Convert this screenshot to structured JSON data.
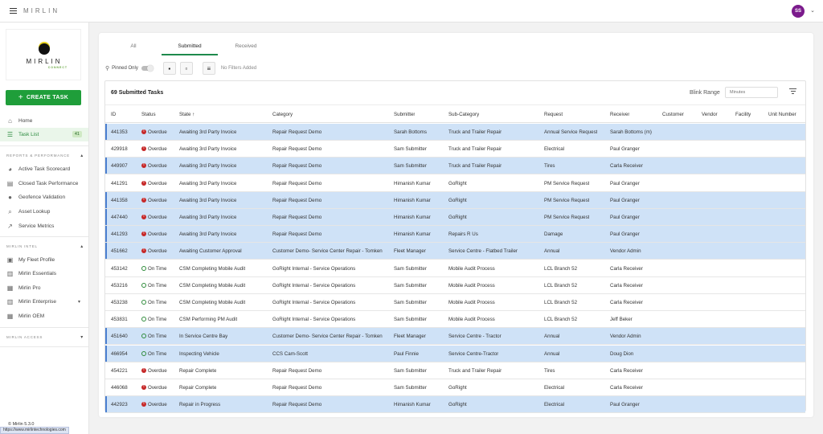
{
  "app": {
    "brand": "MIRLIN",
    "user_initials": "SS"
  },
  "sidebar": {
    "logo_word": "MIRLIN",
    "logo_sub": "CONNECT",
    "create_task": "CREATE TASK",
    "nav": [
      {
        "label": "Home",
        "icon": "home-icon"
      },
      {
        "label": "Task List",
        "icon": "list-icon",
        "badge": "41"
      }
    ],
    "section_reports": "REPORTS & PERFORMANCE",
    "reports": [
      {
        "label": "Active Task Scorecard",
        "icon": "pie-chart-icon"
      },
      {
        "label": "Closed Task Performance",
        "icon": "document-icon"
      },
      {
        "label": "Geofence Validation",
        "icon": "map-pin-icon"
      },
      {
        "label": "Asset Lookup",
        "icon": "search-icon"
      },
      {
        "label": "Service Metrics",
        "icon": "trend-icon"
      }
    ],
    "section_intel": "MIRLIN INTEL",
    "intel": [
      {
        "label": "My Fleet Profile",
        "icon": "profile-icon"
      },
      {
        "label": "Mirlin Essentials",
        "icon": "chart-bars-icon"
      },
      {
        "label": "Mirlin Pro",
        "icon": "building-icon"
      },
      {
        "label": "Mirlin Enterprise",
        "icon": "chart-bars-icon"
      },
      {
        "label": "Mirlin OEM",
        "icon": "building-icon"
      }
    ],
    "section_access": "MIRLIN ACCESS",
    "version": "© Mirlin 5.3.0",
    "status_url": "https://www.mirlintechnologies.com"
  },
  "tabs": [
    "All",
    "Submitted",
    "Received"
  ],
  "toolbar": {
    "pinned_only": "Pinned Only",
    "no_filters": "No Filters Added"
  },
  "table": {
    "title": "69 Submitted Tasks",
    "blink_range_label": "Blink Range",
    "blink_range_placeholder": "Minutes",
    "columns": [
      "ID",
      "Status",
      "State ↑",
      "Category",
      "Submitter",
      "Sub-Category",
      "Request",
      "Receiver",
      "Customer",
      "Vendor",
      "Facility",
      "Unit Number"
    ],
    "rows": [
      {
        "id": "441353",
        "status": "Overdue",
        "state": "Awaiting 3rd Party Invoice",
        "category": "Repair Request Demo",
        "submitter": "Sarah Bottoms",
        "subcategory": "Truck and Trailer Repair",
        "request": "Annual Service Request",
        "receiver": "Sarah Bottoms (m)"
      },
      {
        "id": "429918",
        "status": "Overdue",
        "state": "Awaiting 3rd Party Invoice",
        "category": "Repair Request Demo",
        "submitter": "Sam Submitter",
        "subcategory": "Truck and Trailer Repair",
        "request": "Electrical",
        "receiver": "Paul Granger"
      },
      {
        "id": "449907",
        "status": "Overdue",
        "state": "Awaiting 3rd Party Invoice",
        "category": "Repair Request Demo",
        "submitter": "Sam Submitter",
        "subcategory": "Truck and Trailer Repair",
        "request": "Tires",
        "receiver": "Carla Receiver"
      },
      {
        "id": "441291",
        "status": "Overdue",
        "state": "Awaiting 3rd Party Invoice",
        "category": "Repair Request Demo",
        "submitter": "Himanish Kumar",
        "subcategory": "GoRight",
        "request": "PM Service Request",
        "receiver": "Paul Granger"
      },
      {
        "id": "441358",
        "status": "Overdue",
        "state": "Awaiting 3rd Party Invoice",
        "category": "Repair Request Demo",
        "submitter": "Himanish Kumar",
        "subcategory": "GoRight",
        "request": "PM Service Request",
        "receiver": "Paul Granger"
      },
      {
        "id": "447440",
        "status": "Overdue",
        "state": "Awaiting 3rd Party Invoice",
        "category": "Repair Request Demo",
        "submitter": "Himanish Kumar",
        "subcategory": "GoRight",
        "request": "PM Service Request",
        "receiver": "Paul Granger"
      },
      {
        "id": "441293",
        "status": "Overdue",
        "state": "Awaiting 3rd Party Invoice",
        "category": "Repair Request Demo",
        "submitter": "Himanish Kumar",
        "subcategory": "Repairs R Us",
        "request": "Damage",
        "receiver": "Paul Granger"
      },
      {
        "id": "451662",
        "status": "Overdue",
        "state": "Awaiting Customer Approval",
        "category": "Customer Demo- Service Center Repair - Tomken",
        "submitter": "Fleet Manager",
        "subcategory": "Service Centre - Flatbed Trailer",
        "request": "Annual",
        "receiver": "Vendor Admin"
      },
      {
        "id": "453142",
        "status": "On Time",
        "state": "CSM Completing Mobile Audit",
        "category": "GoRight Internal - Service Operations",
        "submitter": "Sam Submitter",
        "subcategory": "Mobile Audit Process",
        "request": "LCL Branch 52",
        "receiver": "Carla Receiver"
      },
      {
        "id": "453216",
        "status": "On Time",
        "state": "CSM Completing Mobile Audit",
        "category": "GoRight Internal - Service Operations",
        "submitter": "Sam Submitter",
        "subcategory": "Mobile Audit Process",
        "request": "LCL Branch 52",
        "receiver": "Carla Receiver"
      },
      {
        "id": "453238",
        "status": "On Time",
        "state": "CSM Completing Mobile Audit",
        "category": "GoRight Internal - Service Operations",
        "submitter": "Sam Submitter",
        "subcategory": "Mobile Audit Process",
        "request": "LCL Branch 52",
        "receiver": "Carla Receiver"
      },
      {
        "id": "453831",
        "status": "On Time",
        "state": "CSM Performing PM Audit",
        "category": "GoRight Internal - Service Operations",
        "submitter": "Sam Submitter",
        "subcategory": "Mobile Audit Process",
        "request": "LCL Branch 52",
        "receiver": "Jeff Beker"
      },
      {
        "id": "451640",
        "status": "On Time",
        "state": "In Service Centre Bay",
        "category": "Customer Demo- Service Center Repair - Tomken",
        "submitter": "Fleet Manager",
        "subcategory": "Service Centre - Tractor",
        "request": "Annual",
        "receiver": "Vendor Admin"
      },
      {
        "id": "466954",
        "status": "On Time",
        "state": "Inspecting Vehicle",
        "category": "CCS Cam-Scott",
        "submitter": "Paul Finnie",
        "subcategory": "Service Centre-Tractor",
        "request": "Annual",
        "receiver": "Doug Dion"
      },
      {
        "id": "454221",
        "status": "Overdue",
        "state": "Repair Complete",
        "category": "Repair Request Demo",
        "submitter": "Sam Submitter",
        "subcategory": "Truck and Trailer Repair",
        "request": "Tires",
        "receiver": "Carla Receiver"
      },
      {
        "id": "446068",
        "status": "Overdue",
        "state": "Repair Complete",
        "category": "Repair Request Demo",
        "submitter": "Sam Submitter",
        "subcategory": "GoRight",
        "request": "Electrical",
        "receiver": "Carla Receiver"
      },
      {
        "id": "442923",
        "status": "Overdue",
        "state": "Repair in Progress",
        "category": "Repair Request Demo",
        "submitter": "Himanish Kumar",
        "subcategory": "GoRight",
        "request": "Electrical",
        "receiver": "Paul Granger"
      }
    ]
  },
  "colors": {
    "accent_green": "#1f9e3a",
    "row_highlight": "#cfe2f7",
    "overdue": "#c62828",
    "on_time": "#2e8b3a",
    "avatar": "#7b1b8c"
  }
}
